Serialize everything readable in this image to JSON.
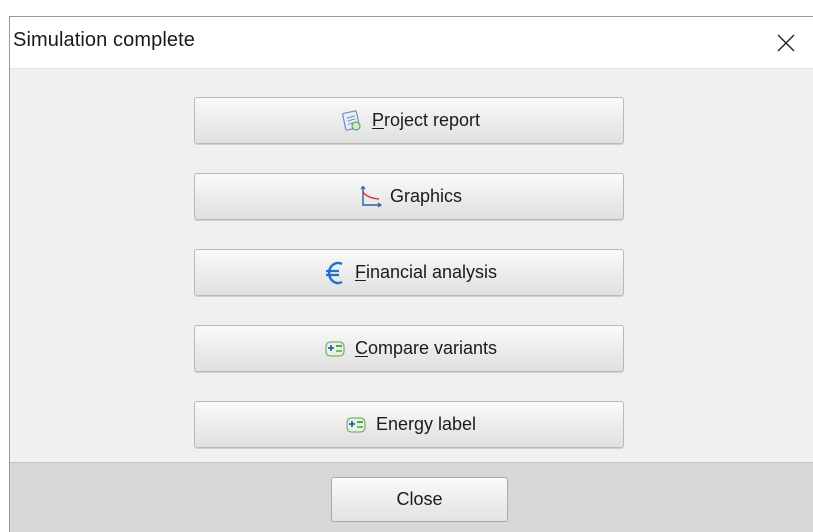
{
  "window": {
    "title": "Simulation complete",
    "close_icon": "close-icon"
  },
  "buttons": [
    {
      "prefix": "",
      "mnemonic": "P",
      "rest": "roject report",
      "icon": "report-icon"
    },
    {
      "prefix": "",
      "mnemonic": "",
      "rest": "Graphics",
      "icon": "graph-axes-icon"
    },
    {
      "prefix": "",
      "mnemonic": "F",
      "rest": "inancial analysis",
      "icon": "euro-icon"
    },
    {
      "prefix": "",
      "mnemonic": "C",
      "rest": "ompare variants",
      "icon": "variants-icon"
    },
    {
      "prefix": "",
      "mnemonic": "",
      "rest": "Energy label",
      "icon": "variants-icon"
    }
  ],
  "footer": {
    "close_label": "Close"
  },
  "colors": {
    "euro": "#1f6fd1",
    "graph_red": "#d23a3a",
    "graph_blue": "#2b5fae",
    "icon_green": "#3aa43a"
  }
}
